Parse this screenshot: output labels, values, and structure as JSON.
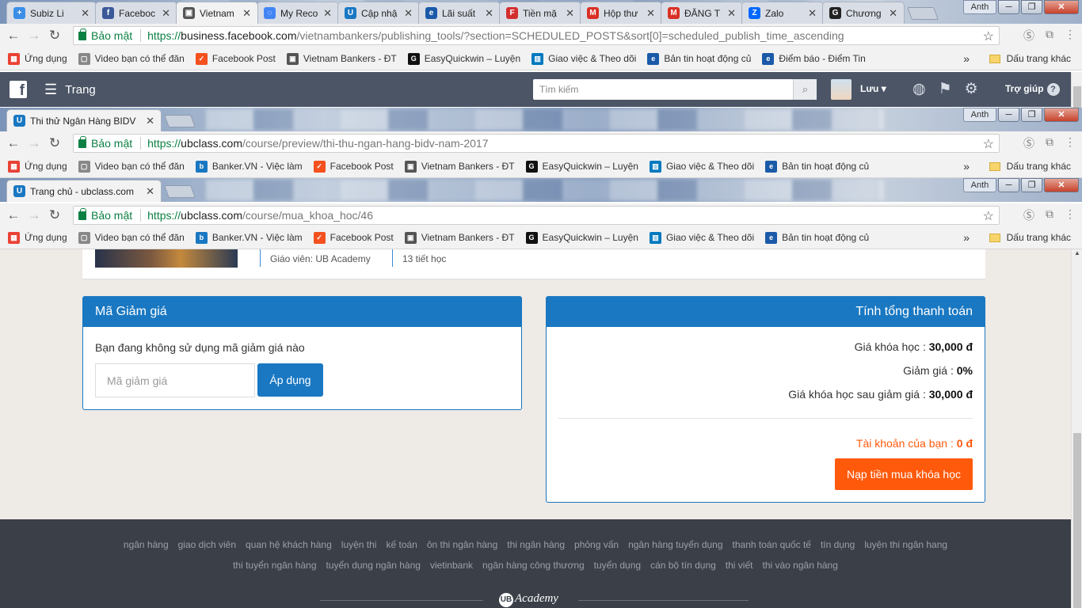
{
  "window1": {
    "tabs": [
      {
        "title": "Subiz Li",
        "color": "#3b8ee8",
        "glyph": "+"
      },
      {
        "title": "Faceboc",
        "color": "#3b5998",
        "glyph": "f"
      },
      {
        "title": "Vietnam",
        "color": "#555555",
        "glyph": "▣"
      },
      {
        "title": "My Reco",
        "color": "#4285f4",
        "glyph": "◌"
      },
      {
        "title": "Cập nhậ",
        "color": "#1a78c2",
        "glyph": "U"
      },
      {
        "title": "Lãi suất",
        "color": "#1a5aa8",
        "glyph": "e"
      },
      {
        "title": "Tiền mặ",
        "color": "#d32f2f",
        "glyph": "F"
      },
      {
        "title": "Hộp thư",
        "color": "#d93025",
        "glyph": "M"
      },
      {
        "title": "ĐĂNG T",
        "color": "#d93025",
        "glyph": "M"
      },
      {
        "title": "Zalo",
        "color": "#0068ff",
        "glyph": "Z"
      },
      {
        "title": "Chương",
        "color": "#222222",
        "glyph": "G"
      }
    ],
    "url": {
      "scheme": "https://",
      "host": "business.facebook.com",
      "path": "/vietnambankers/publishing_tools/?section=SCHEDULED_POSTS&sort[0]=scheduled_publish_time_ascending"
    }
  },
  "window2": {
    "tab_title": "Thi thử Ngân Hàng BIDV",
    "url": {
      "scheme": "https://",
      "host": "ubclass.com",
      "path": "/course/preview/thi-thu-ngan-hang-bidv-nam-2017"
    }
  },
  "window3": {
    "tab_title": "Trang chủ - ubclass.com",
    "url": {
      "scheme": "https://",
      "host": "ubclass.com",
      "path": "/course/mua_khoa_hoc/46"
    }
  },
  "browser": {
    "secure_label": "Bảo mật",
    "user_badge": "Anth",
    "bookmarks_more": "»",
    "other_bookmarks": "Dấu trang khác",
    "bookmarks1": [
      {
        "label": "Ứng dụng",
        "color": "#e94235",
        "glyph": "▦"
      },
      {
        "label": "Video bạn có thể đăn",
        "color": "#888888",
        "glyph": "▢"
      },
      {
        "label": "Facebook Post",
        "color": "#f4511e",
        "glyph": "✓"
      },
      {
        "label": "Vietnam Bankers - ĐT",
        "color": "#555555",
        "glyph": "▣"
      },
      {
        "label": "EasyQuickwin – Luyện",
        "color": "#111111",
        "glyph": "G"
      },
      {
        "label": "Giao việc & Theo dõi",
        "color": "#0079bf",
        "glyph": "▥"
      },
      {
        "label": "Bản tin hoạt động củ",
        "color": "#1a5aa8",
        "glyph": "e"
      },
      {
        "label": "Điểm báo - Điểm Tin",
        "color": "#1a5aa8",
        "glyph": "e"
      }
    ],
    "bookmarks2": [
      {
        "label": "Ứng dụng",
        "color": "#e94235",
        "glyph": "▦"
      },
      {
        "label": "Video bạn có thể đăn",
        "color": "#888888",
        "glyph": "▢"
      },
      {
        "label": "Banker.VN - Việc làm",
        "color": "#1a78c2",
        "glyph": "b"
      },
      {
        "label": "Facebook Post",
        "color": "#f4511e",
        "glyph": "✓"
      },
      {
        "label": "Vietnam Bankers - ĐT",
        "color": "#555555",
        "glyph": "▣"
      },
      {
        "label": "EasyQuickwin – Luyện",
        "color": "#111111",
        "glyph": "G"
      },
      {
        "label": "Giao việc & Theo dõi",
        "color": "#0079bf",
        "glyph": "▥"
      },
      {
        "label": "Bản tin hoạt động củ",
        "color": "#1a5aa8",
        "glyph": "e"
      }
    ]
  },
  "facebook": {
    "menu_label": "Trang",
    "search_placeholder": "Tìm kiếm",
    "user_name": "Lưu",
    "help_label": "Trợ giúp"
  },
  "course": {
    "teacher": "Giáo viên: UB Academy",
    "lessons": "13 tiết học"
  },
  "coupon": {
    "title": "Mã Giảm giá",
    "status": "Bạn đang không sử dụng mã giảm giá nào",
    "placeholder": "Mã giảm giá",
    "apply_label": "Áp dụng"
  },
  "payment": {
    "title": "Tính tổng thanh toán",
    "price_label": "Giá khóa học :",
    "price_value": "30,000 đ",
    "discount_label": "Giảm giá :",
    "discount_value": "0%",
    "after_label": "Giá khóa học sau giảm giá :",
    "after_value": "30,000 đ",
    "balance_label": "Tài khoản của bạn :",
    "balance_value": "0 đ",
    "topup_label": "Nạp tiền mua khóa học"
  },
  "footer": {
    "tags_row1": [
      "ngân hàng",
      "giao dịch viên",
      "quan hệ khách hàng",
      "luyện thi",
      "kế toán",
      "ôn thi ngân hàng",
      "thi ngân hàng",
      "phỏng vấn",
      "ngân hàng tuyển dụng",
      "thanh toán quốc tế",
      "tín dụng",
      "luyện thi ngân hang"
    ],
    "tags_row2": [
      "thi tuyển ngân hàng",
      "tuyển dụng ngân hàng",
      "vietinbank",
      "ngân hàng công thương",
      "tuyển dụng",
      "cán bộ tín dụng",
      "thi viết",
      "thi vào ngân hàng"
    ],
    "logo_mark": "UB",
    "logo_text": "Academy"
  },
  "colors": {
    "primary": "#1a78c2",
    "accent": "#ff5a0c",
    "facebook_bar": "#4b5566",
    "footer_bg": "#3a3f48"
  }
}
